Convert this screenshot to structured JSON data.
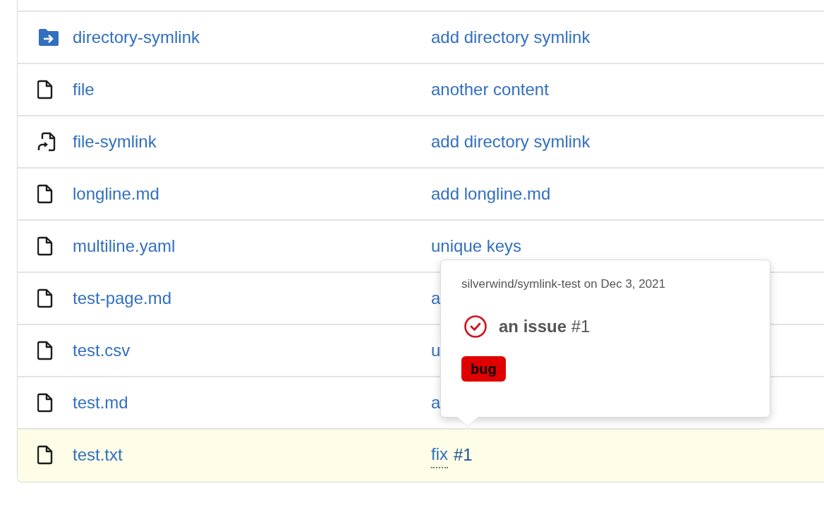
{
  "rows": [
    {
      "kind": "directory-symlink",
      "name": "directory-symlink",
      "highlighted": false,
      "message": [
        {
          "text": "add directory symlink",
          "kind": "link"
        }
      ]
    },
    {
      "kind": "file",
      "name": "file",
      "highlighted": false,
      "message": [
        {
          "text": "another content",
          "kind": "link"
        }
      ]
    },
    {
      "kind": "file-symlink",
      "name": "file-symlink",
      "highlighted": false,
      "message": [
        {
          "text": "add directory symlink",
          "kind": "link"
        }
      ]
    },
    {
      "kind": "file",
      "name": "longline.md",
      "highlighted": false,
      "message": [
        {
          "text": "add longline.md",
          "kind": "link"
        }
      ]
    },
    {
      "kind": "file",
      "name": "multiline.yaml",
      "highlighted": false,
      "message": [
        {
          "text": "unique keys",
          "kind": "link"
        }
      ]
    },
    {
      "kind": "file",
      "name": "test-page.md",
      "highlighted": false,
      "message": [
        {
          "text": "a",
          "kind": "link"
        }
      ]
    },
    {
      "kind": "file",
      "name": "test.csv",
      "highlighted": false,
      "message": [
        {
          "text": "u",
          "kind": "link"
        }
      ]
    },
    {
      "kind": "file",
      "name": "test.md",
      "highlighted": false,
      "message": [
        {
          "text": "a",
          "kind": "link"
        }
      ]
    },
    {
      "kind": "file",
      "name": "test.txt",
      "highlighted": true,
      "message": [
        {
          "text": "fix",
          "kind": "tooltip-link"
        },
        {
          "text": "#1",
          "kind": "ref"
        }
      ]
    }
  ],
  "popover": {
    "repo_line": "silverwind/symlink-test on Dec 3, 2021",
    "issue_title": "an issue",
    "issue_number": "#1",
    "closed": true,
    "labels": [
      {
        "text": "bug",
        "color": "#e00000"
      }
    ]
  }
}
